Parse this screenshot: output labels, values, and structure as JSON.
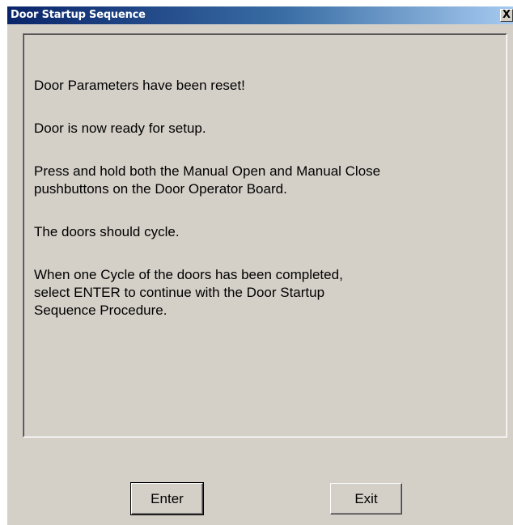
{
  "window": {
    "title": "Door Startup Sequence",
    "close_glyph": "X"
  },
  "message": {
    "line1": "Door Parameters have been reset!",
    "line2": "Door is now ready for setup.",
    "line3a": "Press and hold both the Manual Open and Manual Close",
    "line3b": "pushbuttons on the Door Operator Board.",
    "line4": "The doors should cycle.",
    "line5a": "When one Cycle of the doors has been completed,",
    "line5b": "select ENTER to continue with the Door Startup",
    "line5c": "Sequence Procedure."
  },
  "buttons": {
    "enter_label": "Enter",
    "exit_label": "Exit"
  },
  "colors": {
    "title_gradient_start": "#0a246a",
    "title_gradient_end": "#a6caf0",
    "face": "#d4d0c8"
  }
}
